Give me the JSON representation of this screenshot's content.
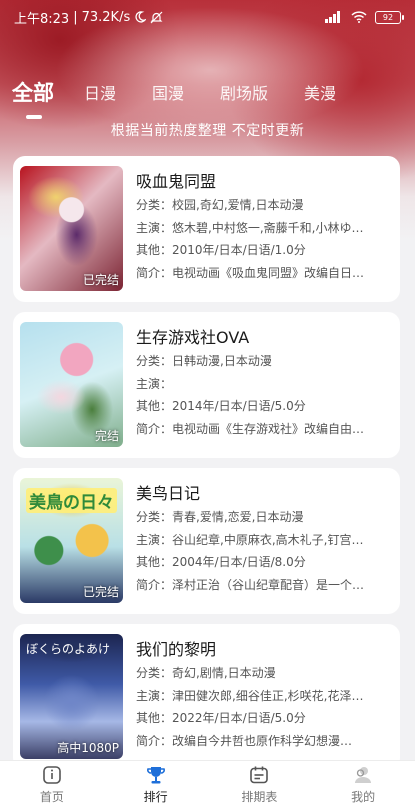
{
  "status_bar": {
    "time": "上午8:23",
    "separator": "|",
    "net_speed": "73.2K/s",
    "battery": "92"
  },
  "tabs": [
    {
      "label": "全部",
      "active": true
    },
    {
      "label": "日漫",
      "active": false
    },
    {
      "label": "国漫",
      "active": false
    },
    {
      "label": "剧场版",
      "active": false
    },
    {
      "label": "美漫",
      "active": false
    }
  ],
  "subtitle": "根据当前热度整理 不定时更新",
  "items": [
    {
      "title": "吸血鬼同盟",
      "badge": "已完结",
      "category": "分类：校园,奇幻,爱情,日本动漫",
      "cast": "主演：悠木碧,中村悠一,斋藤千和,小林ゆ…",
      "other": "其他：2010年/日本/日语/1.0分",
      "intro": "简介：电视动画《吸血鬼同盟》改编自日…"
    },
    {
      "title": "生存游戏社OVA",
      "badge": "完结",
      "category": "分类：日韩动漫,日本动漫",
      "cast": "主演：",
      "other": "其他：2014年/日本/日语/5.0分",
      "intro": "简介：电视动画《生存游戏社》改编自由…"
    },
    {
      "title": "美鸟日记",
      "badge": "已完结",
      "poster_text": "美鳥の日々",
      "category": "分类：青春,爱情,恋爱,日本动漫",
      "cast": "主演：谷山纪章,中原麻衣,高木礼子,钉宫…",
      "other": "其他：2004年/日本/日语/8.0分",
      "intro": "简介：泽村正治（谷山纪章配音）是一个…"
    },
    {
      "title": "我们的黎明",
      "badge": "高中1080P",
      "poster_text": "ぼくらのよあけ",
      "category": "分类：奇幻,剧情,日本动漫",
      "cast": "主演：津田健次郎,细谷佳正,杉咲花,花泽…",
      "other": "其他：2022年/日本/日语/5.0分",
      "intro": "简介：改编自今井哲也原作科学幻想漫…"
    }
  ],
  "bottom_nav": [
    {
      "label": "首页",
      "icon": "home-icon",
      "active": false
    },
    {
      "label": "排行",
      "icon": "trophy-icon",
      "active": true
    },
    {
      "label": "排期表",
      "icon": "calendar-icon",
      "active": false
    },
    {
      "label": "我的",
      "icon": "profile-icon",
      "active": false
    }
  ],
  "colors": {
    "accent": "#1e6fd9",
    "hero": "#b8303a"
  }
}
